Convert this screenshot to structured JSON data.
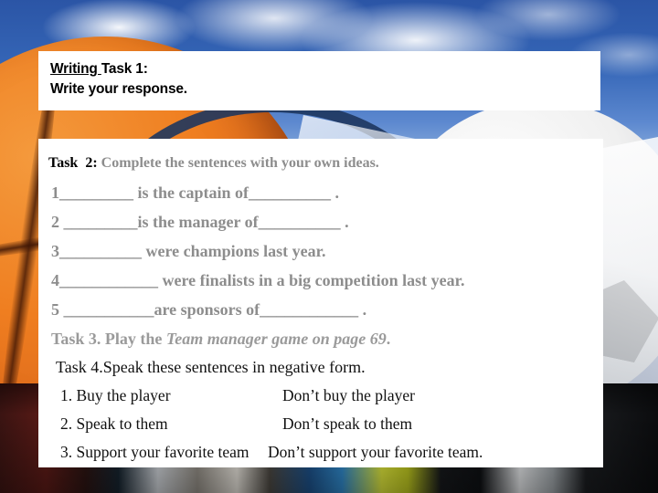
{
  "slide": {
    "background_theme": "sports-collage",
    "colors": {
      "panel": "#ffffff",
      "sky_blue": "#3566b7",
      "basketball_orange": "#ef7e20",
      "gray_text": "#8d8d8d",
      "black_text": "#000000"
    }
  },
  "title_panel": {
    "line1_underlined": "Writing ",
    "line1_rest": "Task 1:",
    "line2": "Write your response."
  },
  "body_panel": {
    "task2": {
      "label": "Task  2:",
      "description": " Complete the sentences with your own ideas."
    },
    "fill_lines": [
      "1_________ is the captain of__________ .",
      "2 _________is the manager of__________ .",
      "3__________ were champions last year.",
      "4____________ were finalists in a big competition last year.",
      "5 ___________are sponsors of____________ ."
    ],
    "task3": {
      "plain": "Task 3. Play the ",
      "italic": "Team manager game on page 69",
      "end": "."
    },
    "task4": {
      "heading": "Task 4.Speak these sentences in negative form."
    },
    "negative_rows": [
      {
        "affirmative": "1. Buy the player",
        "negative": "Don’t buy the player"
      },
      {
        "affirmative": "2. Speak to them",
        "negative": "Don’t speak to them"
      },
      {
        "affirmative": "3. Support your favorite team",
        "negative": "Don’t support your favorite team."
      }
    ]
  }
}
